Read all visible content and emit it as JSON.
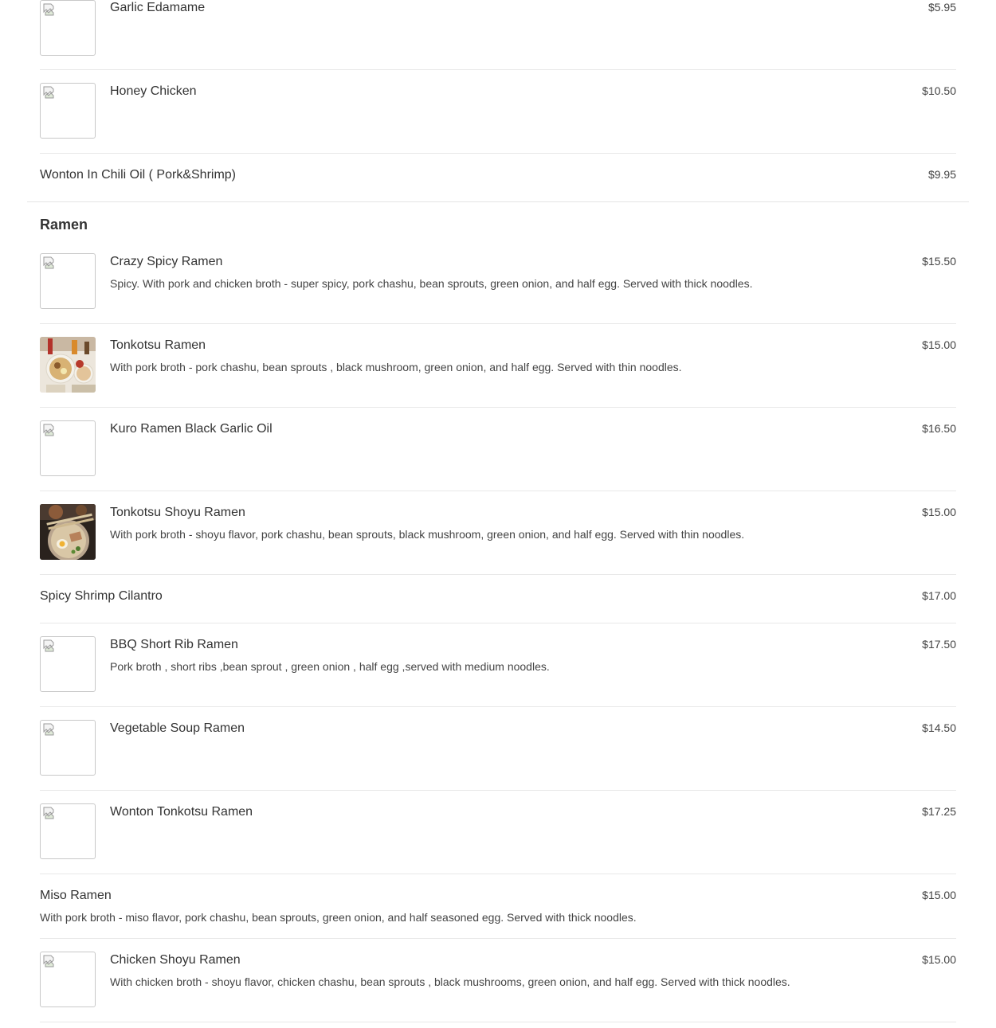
{
  "items_top": [
    {
      "name": "Garlic Edamame",
      "price": "$5.95"
    },
    {
      "name": "Honey Chicken",
      "price": "$10.50"
    },
    {
      "name": "Wonton In Chili Oil ( Pork&Shrimp)",
      "price": "$9.95"
    }
  ],
  "ramen": {
    "title": "Ramen",
    "items": [
      {
        "name": "Crazy Spicy Ramen",
        "price": "$15.50",
        "description": "Spicy. With pork and chicken broth - super spicy, pork chashu, bean sprouts, green onion, and half egg. Served with thick noodles."
      },
      {
        "name": "Tonkotsu Ramen",
        "price": "$15.00",
        "description": "With pork broth - pork chashu, bean sprouts , black mushroom, green onion, and half egg. Served with thin noodles."
      },
      {
        "name": "Kuro Ramen Black Garlic Oil",
        "price": "$16.50"
      },
      {
        "name": "Tonkotsu Shoyu Ramen",
        "price": "$15.00",
        "description": "With pork broth - shoyu flavor, pork chashu, bean sprouts, black mushroom, green onion, and half egg. Served with thin noodles."
      },
      {
        "name": "Spicy Shrimp Cilantro",
        "price": "$17.00"
      },
      {
        "name": "BBQ Short Rib Ramen",
        "price": "$17.50",
        "description": "Pork broth , short ribs ,bean sprout , green onion , half egg ,served with medium noodles."
      },
      {
        "name": "Vegetable Soup Ramen",
        "price": "$14.50"
      },
      {
        "name": "Wonton Tonkotsu Ramen",
        "price": "$17.25"
      },
      {
        "name": "Miso Ramen",
        "price": "$15.00",
        "description": "With pork broth - miso flavor, pork chashu, bean sprouts, green onion, and half seasoned egg. Served with thick noodles."
      },
      {
        "name": "Chicken Shoyu Ramen",
        "price": "$15.00",
        "description": "With chicken broth - shoyu flavor, chicken chashu, bean sprouts , black mushrooms, green onion, and half egg. Served with thick noodles."
      }
    ]
  }
}
